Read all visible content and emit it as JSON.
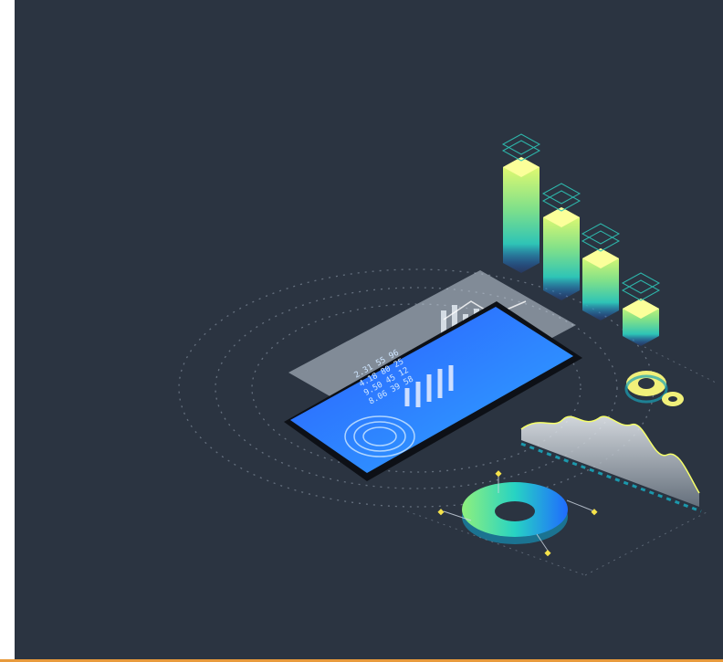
{
  "illustration": {
    "background_color": "#2b3441",
    "accent_strip_color": "#e89a3c",
    "phone_screen_text": [
      "2.31 55 96",
      "4.18 80 25",
      "9.50 45 12",
      "8.06 39 58"
    ],
    "colors": {
      "bar_top": "#f6ff6a",
      "bar_mid": "#2ec4b6",
      "bar_bottom": "#1b4fd1",
      "screen": "#1f6bff",
      "ring": "#27d3c3",
      "gear": "#f1f07a"
    }
  }
}
